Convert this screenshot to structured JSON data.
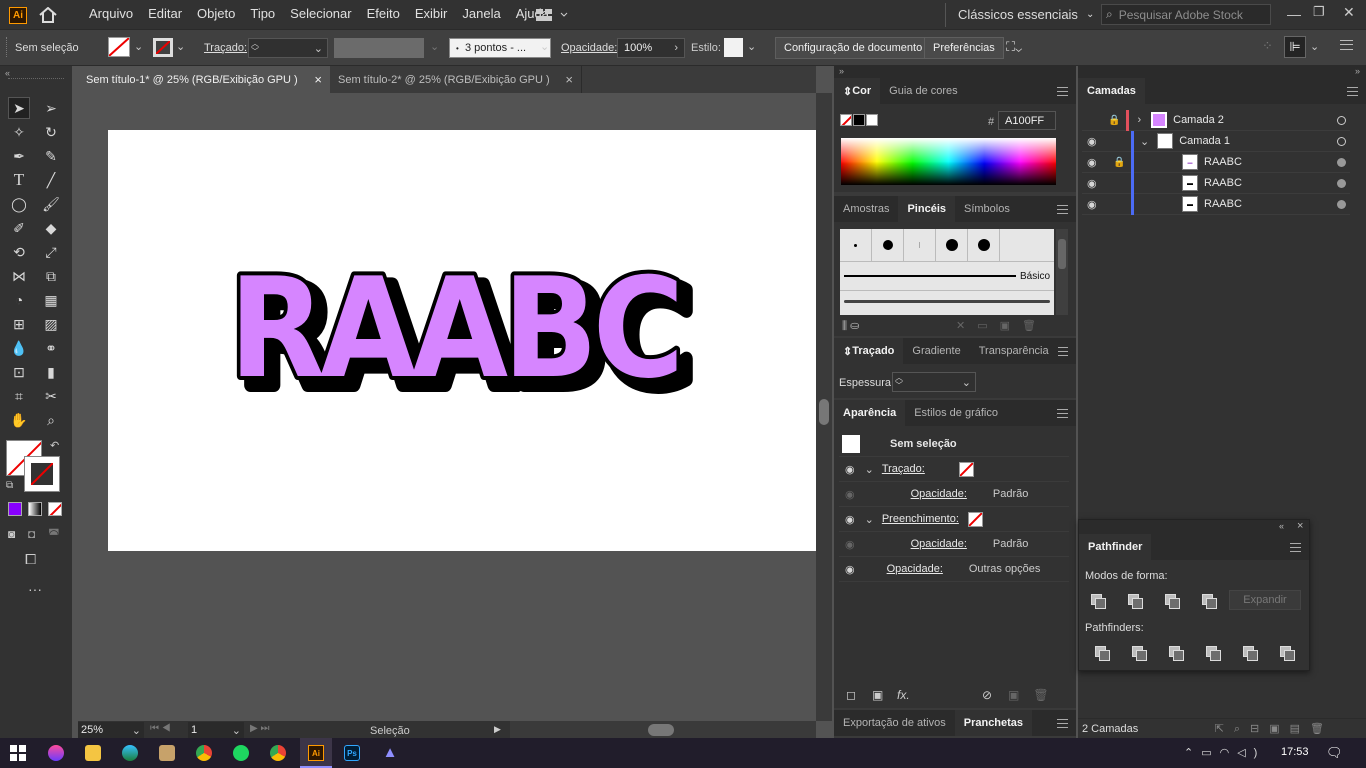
{
  "app": {
    "logo": "Ai",
    "colors": {
      "accent": "#ff9a00",
      "fill": "#d685ff",
      "selection": "#4a90e2"
    }
  },
  "menu": {
    "items": [
      "Arquivo",
      "Editar",
      "Objeto",
      "Tipo",
      "Selecionar",
      "Efeito",
      "Exibir",
      "Janela",
      "Ajuda"
    ],
    "workspace": "Clássicos essenciais",
    "search_placeholder": "Pesquisar Adobe Stock"
  },
  "control": {
    "selection": "Sem seleção",
    "stroke_label": "Traçado:",
    "brush": "3 pontos - ...",
    "opacity_label": "Opacidade:",
    "opacity": "100%",
    "style_label": "Estilo:",
    "doc_setup": "Configuração de documento",
    "prefs": "Preferências"
  },
  "tabs": [
    {
      "label": "Sem título-1* @ 25% (RGB/Exibição GPU )",
      "close": "×"
    },
    {
      "label": "Sem título-2* @ 25% (RGB/Exibição GPU )",
      "close": "×"
    }
  ],
  "artwork": {
    "text": "RAABC"
  },
  "status": {
    "zoom": "25%",
    "page": "1",
    "tool": "Seleção"
  },
  "color_panel": {
    "tabs": [
      "Cor",
      "Guia de cores"
    ],
    "hex_label": "#",
    "hex": "A100FF"
  },
  "brushes_panel": {
    "tabs": [
      "Amostras",
      "Pincéis",
      "Símbolos"
    ],
    "basic": "Básico"
  },
  "stroke_panel": {
    "tabs": [
      "Traçado",
      "Gradiente",
      "Transparência"
    ],
    "weight_label": "Espessura:"
  },
  "appearance_panel": {
    "tabs": [
      "Aparência",
      "Estilos de gráfico"
    ],
    "none": "Sem seleção",
    "stroke": "Traçado:",
    "fill": "Preenchimento:",
    "opacity": "Opacidade:",
    "default": "Padrão",
    "more": "Outras opções"
  },
  "bottom_tabs": [
    "Exportação de ativos",
    "Pranchetas"
  ],
  "layers_panel": {
    "title": "Camadas",
    "layers": [
      "Camada 2",
      "Camada 1"
    ],
    "items": [
      "RAABC",
      "RAABC",
      "RAABC"
    ],
    "count": "2 Camadas"
  },
  "pathfinder": {
    "title": "Pathfinder",
    "shape_modes": "Modos de forma:",
    "expand": "Expandir",
    "pathfinders": "Pathfinders:"
  },
  "taskbar": {
    "time": "17:53"
  }
}
